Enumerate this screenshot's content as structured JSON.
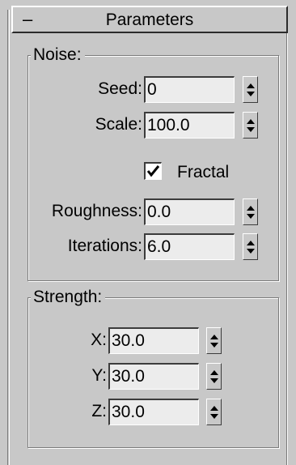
{
  "rollout": {
    "collapse_symbol": "–",
    "title": "Parameters"
  },
  "noise": {
    "label": "Noise:",
    "seed": {
      "label": "Seed:",
      "value": "0"
    },
    "scale": {
      "label": "Scale:",
      "value": "100.0"
    },
    "fractal": {
      "label": "Fractal",
      "checked": true
    },
    "roughness": {
      "label": "Roughness:",
      "value": "0.0"
    },
    "iterations": {
      "label": "Iterations:",
      "value": "6.0"
    }
  },
  "strength": {
    "label": "Strength:",
    "x": {
      "label": "X:",
      "value": "30.0"
    },
    "y": {
      "label": "Y:",
      "value": "30.0"
    },
    "z": {
      "label": "Z:",
      "value": "30.0"
    }
  },
  "icons": {
    "spinner": "spinner-arrows-icon",
    "check": "checkmark-icon"
  },
  "colors": {
    "panel_bg": "#c8c8c8",
    "field_bg": "#ececec"
  }
}
